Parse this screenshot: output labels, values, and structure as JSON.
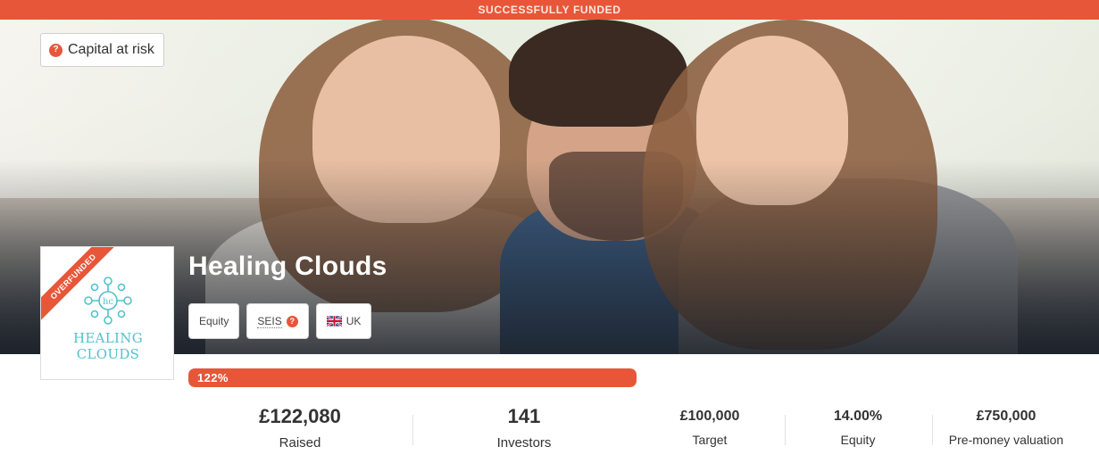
{
  "banner": {
    "status": "SUCCESSFULLY FUNDED"
  },
  "risk": {
    "label": "Capital at risk",
    "icon": "question-icon"
  },
  "company": {
    "name": "Healing Clouds",
    "logo_text": "HEALING CLOUDS",
    "ribbon": "OVERFUNDED"
  },
  "tags": {
    "equity": "Equity",
    "seis": "SEIS",
    "country": "UK",
    "country_icon": "uk-flag-icon"
  },
  "progress": {
    "label": "122%",
    "percent": 122
  },
  "stats": {
    "raised": {
      "value": "£122,080",
      "label": "Raised"
    },
    "investors": {
      "value": "141",
      "label": "Investors"
    },
    "target": {
      "value": "£100,000",
      "label": "Target"
    },
    "equity": {
      "value": "14.00%",
      "label": "Equity"
    },
    "valuation": {
      "value": "£750,000",
      "label": "Pre-money valuation"
    }
  },
  "colors": {
    "accent": "#e8563a",
    "logo": "#52c2cc"
  }
}
